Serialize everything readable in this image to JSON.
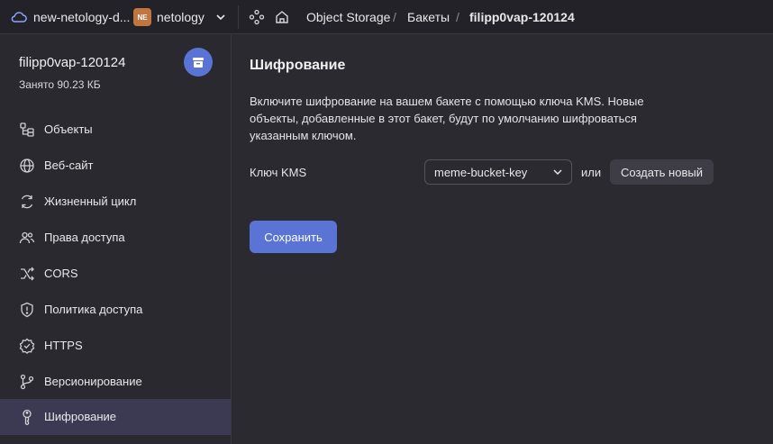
{
  "topbar": {
    "cloud_icon": "cloud-icon",
    "cloud_name": "new-netology-d...",
    "org_badge": "NE",
    "org_name": "netology",
    "chevron_icon": "chevron-down-icon",
    "services_icon": "services-icon",
    "home_icon": "home-icon",
    "breadcrumbs": [
      "Object Storage",
      "Бакеты",
      "filipp0vap-120124"
    ],
    "separator": "/"
  },
  "sidebar": {
    "bucket_name": "filipp0vap-120124",
    "usage": "Занято 90.23 КБ",
    "bucket_icon": "bucket-icon",
    "items": [
      {
        "label": "Объекты",
        "icon": "objects-icon"
      },
      {
        "label": "Веб-сайт",
        "icon": "globe-icon"
      },
      {
        "label": "Жизненный цикл",
        "icon": "lifecycle-icon"
      },
      {
        "label": "Права доступа",
        "icon": "users-icon"
      },
      {
        "label": "CORS",
        "icon": "cors-icon"
      },
      {
        "label": "Политика доступа",
        "icon": "shield-icon"
      },
      {
        "label": "HTTPS",
        "icon": "https-icon"
      },
      {
        "label": "Версионирование",
        "icon": "versioning-icon"
      },
      {
        "label": "Шифрование",
        "icon": "key-icon"
      }
    ],
    "active_index": 8
  },
  "main": {
    "title": "Шифрование",
    "description": "Включите шифрование на вашем бакете с помощью ключа KMS. Новые объекты, добавленные в этот бакет, будут по умолчанию шифроваться указанным ключом.",
    "kms_label": "Ключ KMS",
    "kms_value": "meme-bucket-key",
    "or_text": "или",
    "create_button": "Создать новый",
    "save_button": "Сохранить"
  },
  "colors": {
    "accent": "#5a74d6",
    "background": "#2b2a30",
    "active_nav": "#3b3a52",
    "org_badge": "#c0763f"
  }
}
